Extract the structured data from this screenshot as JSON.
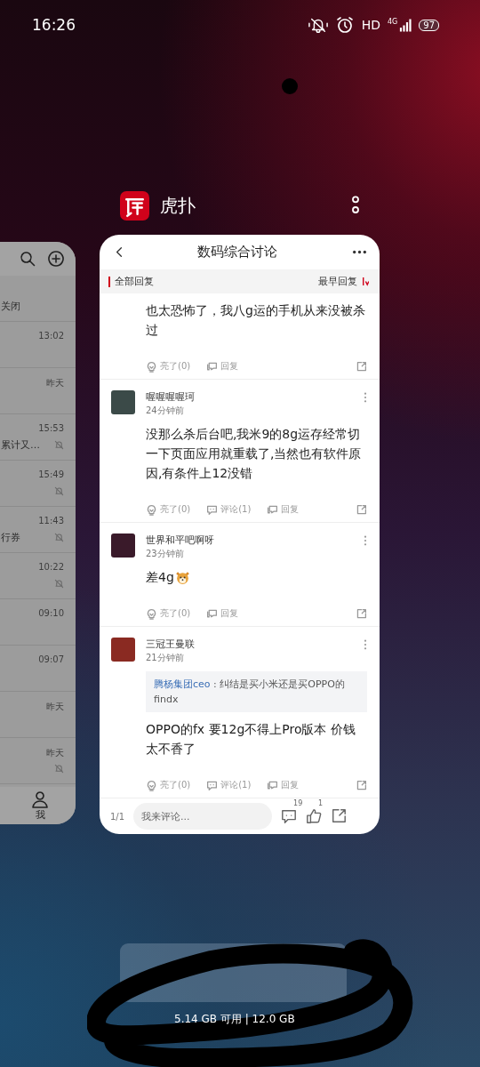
{
  "status_bar": {
    "time": "16:26",
    "hd": "HD",
    "network": "4G",
    "battery": "97"
  },
  "left_card": {
    "rows": [
      {
        "snippet": "关闭",
        "muted": false
      },
      {
        "time": "13:02",
        "muted": false
      },
      {
        "time": "昨天",
        "muted": false
      },
      {
        "time": "15:53",
        "snippet": "累计又…",
        "muted": true
      },
      {
        "time": "15:49",
        "muted": true
      },
      {
        "time": "11:43",
        "snippet": "行券",
        "muted": true
      },
      {
        "time": "10:22",
        "muted": true
      },
      {
        "time": "09:10",
        "muted": false
      },
      {
        "time": "09:07",
        "muted": false
      },
      {
        "time": "昨天",
        "muted": false
      },
      {
        "time": "昨天",
        "muted": true
      }
    ],
    "nav_label": "我"
  },
  "app_header": {
    "name": "虎扑"
  },
  "main_card": {
    "title": "数码综合讨论",
    "filter": {
      "label": "全部回复",
      "sort": "最早回复"
    },
    "comments": [
      {
        "body": "也太恐怖了，我八g运的手机从来没被杀过",
        "actions": [
          {
            "kind": "light",
            "label": "亮了(0)"
          },
          {
            "kind": "reply",
            "label": "回复"
          }
        ]
      },
      {
        "user": "喔喔喔喔珂",
        "time": "24分钟前",
        "body": "没那么杀后台吧,我米9的8g运存经常切一下页面应用就重载了,当然也有软件原因,有条件上12没错",
        "actions": [
          {
            "kind": "light",
            "label": "亮了(0)"
          },
          {
            "kind": "comment",
            "label": "评论(1)"
          },
          {
            "kind": "reply",
            "label": "回复"
          }
        ]
      },
      {
        "user": "世界和平吧啊呀",
        "time": "23分钟前",
        "body": "差4g",
        "emoji": true,
        "actions": [
          {
            "kind": "light",
            "label": "亮了(0)"
          },
          {
            "kind": "reply",
            "label": "回复"
          }
        ]
      },
      {
        "user": "三冠王曼联",
        "time": "21分钟前",
        "quote": {
          "author": "腾杨集团ceo",
          "text": " : 纠结是买小米还是买OPPO的findx"
        },
        "body": "OPPO的fx 要12g不得上Pro版本 价钱太不香了",
        "actions": [
          {
            "kind": "light",
            "label": "亮了(0)"
          },
          {
            "kind": "comment",
            "label": "评论(1)"
          },
          {
            "kind": "reply",
            "label": "回复"
          }
        ]
      }
    ],
    "composer": {
      "page": "1/1",
      "placeholder": "我来评论...",
      "comment_count": "19",
      "like_count": "1"
    }
  },
  "memory": "5.14 GB 可用 | 12.0 GB"
}
